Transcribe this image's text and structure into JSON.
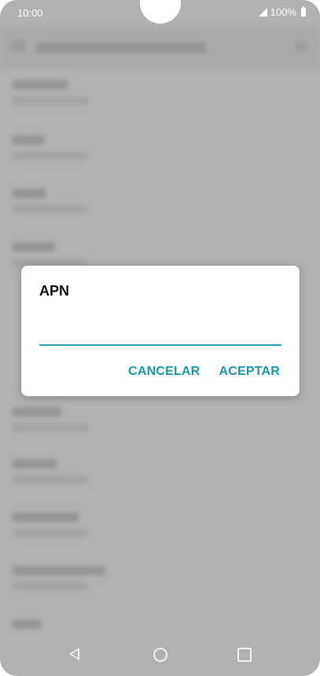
{
  "status_bar": {
    "time": "10:00",
    "battery": "100%"
  },
  "dialog": {
    "title": "APN",
    "input_value": "",
    "cancel_label": "CANCELAR",
    "accept_label": "ACEPTAR"
  },
  "colors": {
    "accent": "#1a9aab",
    "scrim": "#b3b3b3"
  }
}
